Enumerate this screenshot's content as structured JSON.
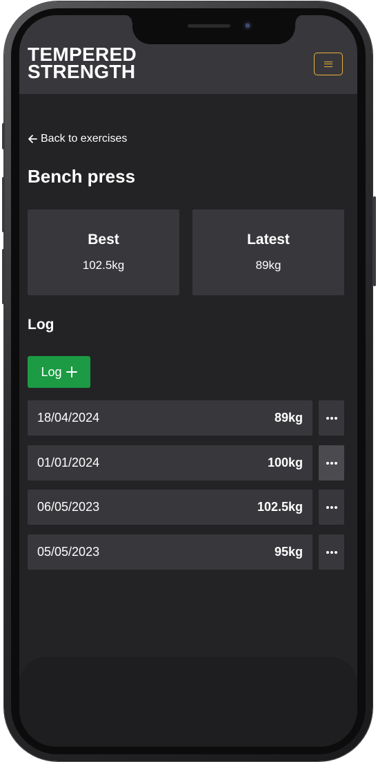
{
  "brand": {
    "line1": "TEMPERED",
    "line2": "STRENGTH"
  },
  "nav": {
    "back_label": "Back to exercises"
  },
  "exercise": {
    "title": "Bench press"
  },
  "stats": {
    "best_label": "Best",
    "best_value": "102.5kg",
    "latest_label": "Latest",
    "latest_value": "89kg"
  },
  "log": {
    "title": "Log",
    "add_label": "Log",
    "entries": [
      {
        "date": "18/04/2024",
        "weight": "89kg"
      },
      {
        "date": "01/01/2024",
        "weight": "100kg"
      },
      {
        "date": "06/05/2023",
        "weight": "102.5kg"
      },
      {
        "date": "05/05/2023",
        "weight": "95kg"
      }
    ]
  },
  "colors": {
    "background": "#232325",
    "card": "#38383c",
    "accent": "#e9b13a",
    "primary_button": "#1c9b44"
  },
  "icons": {
    "menu": "hamburger-icon",
    "back": "arrow-left-icon",
    "add": "plus-icon",
    "more": "more-horizontal-icon"
  }
}
